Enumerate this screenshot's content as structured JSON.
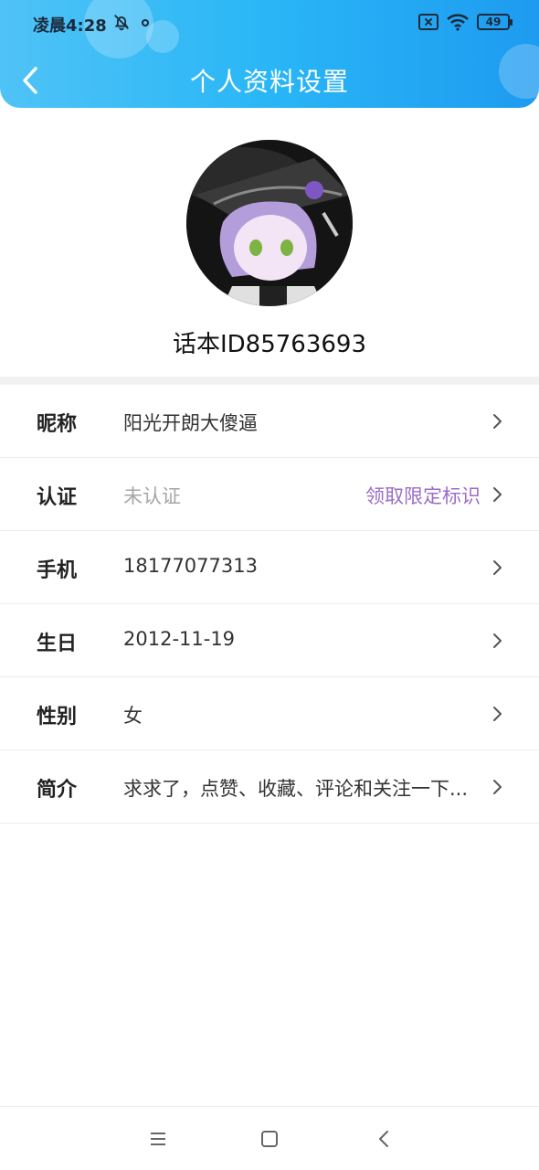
{
  "status_bar": {
    "time": "凌晨4:28",
    "battery": "49",
    "icons": [
      "bell-off-icon",
      "notification-dot-icon",
      "sim-off-icon",
      "wifi-icon",
      "battery-icon"
    ]
  },
  "header": {
    "title": "个人资料设置",
    "back_icon": "chevron-left-icon"
  },
  "profile": {
    "avatar": "avatar-image",
    "id_text": "话本ID85763693"
  },
  "fields": [
    {
      "label": "昵称",
      "value": "阳光开朗大傻逼",
      "muted": false
    },
    {
      "label": "认证",
      "value": "未认证",
      "muted": true,
      "extra": "领取限定标识"
    },
    {
      "label": "手机",
      "value": "18177077313",
      "muted": false
    },
    {
      "label": "生日",
      "value": "2012-11-19",
      "muted": false
    },
    {
      "label": "性别",
      "value": "女",
      "muted": false
    },
    {
      "label": "简介",
      "value": "求求了，点赞、收藏、评论和关注一下...",
      "muted": false
    }
  ],
  "colors": {
    "header_start": "#4fc3f7",
    "header_end": "#1e9bf0",
    "accent_purple": "#9b6cc8",
    "muted_text": "#a6a6a6"
  },
  "nav": {
    "icons": [
      "menu-icon",
      "home-square-icon",
      "back-triangle-icon"
    ]
  }
}
